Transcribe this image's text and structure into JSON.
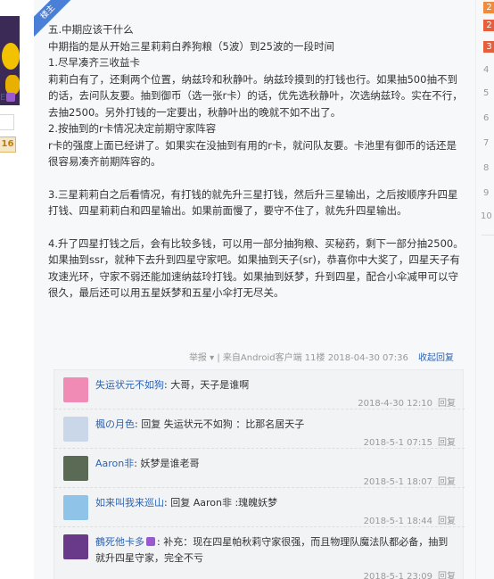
{
  "badge": {
    "label": "楼主"
  },
  "left": {
    "tag_label": "E",
    "level": "16"
  },
  "post": {
    "lines": [
      "五.中期应该干什么",
      "中期指的是从开始三星莉莉白养狗粮（5波）到25波的一段时间",
      "1.尽早凑齐三收益卡",
      "莉莉白有了，还剩两个位置，纳兹玲和秋静叶。纳兹玲摸到的打钱也行。如果抽500抽不到",
      "的话，去问队友要。抽到御币（选一张r卡）的话，优先选秋静叶，次选纳兹玲。实在不行，",
      "去抽2500。另外打钱的一定要出，秋静叶出的晚就不如不出了。",
      "2.按抽到的r卡情况决定前期守家阵容",
      "r卡的强度上面已经讲了。如果实在没抽到有用的r卡，就问队友要。卡池里有御币的话还是",
      "很容易凑齐前期阵容的。",
      "",
      "3.三星莉莉白之后看情况，有打钱的就先升三星打钱，然后升三星输出，之后按顺序升四星",
      "打钱、四星莉莉白和四星输出。如果前面慢了，要守不住了，就先升四星输出。",
      "",
      "4.升了四星打钱之后，会有比较多钱，可以用一部分抽狗粮、买秘药，剩下一部分抽2500。",
      "如果抽到ssr，就种下去升到四星守家吧。如果抽到天子(sr)，恭喜你中大奖了，四星天子有",
      "攻速光环，守家不弱还能加速纳兹玲打钱。如果抽到妖梦，升到四星，配合小伞减甲可以守",
      "很久，最后还可以用五星妖梦和五星小伞打无尽关。"
    ],
    "meta": {
      "report": "举报",
      "report_arrow": "▾",
      "divider": "|",
      "source": "来自Android客户端",
      "floor": "11楼",
      "time": "2018-04-30 07:36",
      "collapse": "收起回复"
    }
  },
  "replies": [
    {
      "user": "失运状元不如狗",
      "text": ": 大哥，天子是谁啊",
      "time": "2018-4-30 12:10",
      "reply": "回复",
      "avatar_color": "#f08bb5"
    },
    {
      "user": "楓の月色",
      "text": ": 回复 失运状元不如狗 ：比那名居天子",
      "time": "2018-5-1 07:15",
      "reply": "回复",
      "avatar_color": "#c9d7e8"
    },
    {
      "user": "Aaron非",
      "text": ": 妖梦是谁老哥",
      "time": "2018-5-1 18:07",
      "reply": "回复",
      "avatar_color": "#5a6a55"
    },
    {
      "user": "如来叫我来巡山",
      "text": ": 回复 Aaron非 :瑰魄妖梦",
      "time": "2018-5-1 18:44",
      "reply": "回复",
      "avatar_color": "#8fc3e8"
    },
    {
      "user": "鶴死他卡多",
      "text": ": 补充：现在四星帕秋莉守家很强，而且物理队魔法队都必备，抽到",
      "text2": "就升四星守家，完全不亏",
      "time": "2018-5-1 23:09",
      "reply": "回复",
      "avatar_color": "#6a3a8a"
    }
  ],
  "sidebar": {
    "ranks": [
      "2",
      "2",
      "3",
      "4",
      "5",
      "6",
      "7",
      "8",
      "9",
      "10"
    ]
  }
}
